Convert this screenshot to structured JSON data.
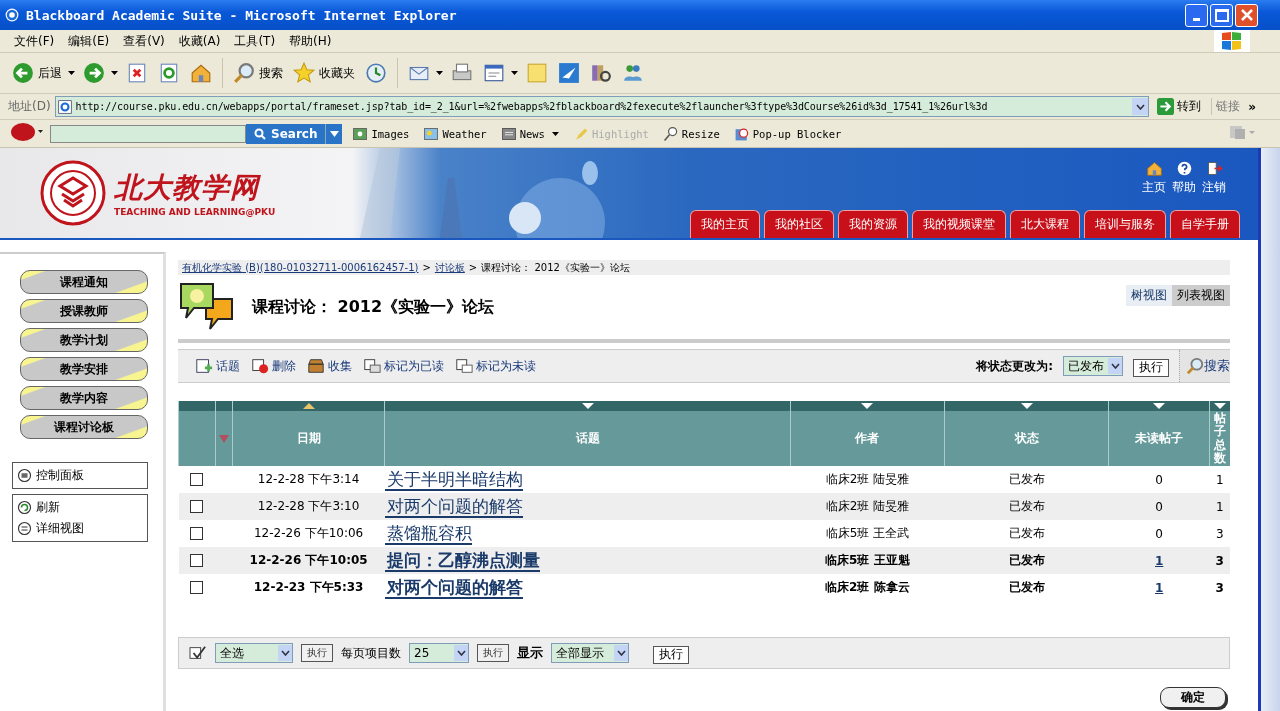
{
  "window": {
    "title": "Blackboard Academic Suite - Microsoft Internet Explorer"
  },
  "menu": [
    "文件(F)",
    "编辑(E)",
    "查看(V)",
    "收藏(A)",
    "工具(T)",
    "帮助(H)"
  ],
  "toolbar": [
    {
      "kind": "back",
      "label": "后退",
      "dropdown": true
    },
    {
      "kind": "forward",
      "dropdown": true
    },
    {
      "kind": "stop"
    },
    {
      "kind": "refresh"
    },
    {
      "kind": "home"
    },
    {
      "kind": "search",
      "label": "搜索"
    },
    {
      "kind": "favorites",
      "label": "收藏夹"
    },
    {
      "kind": "history"
    },
    {
      "kind": "mail",
      "dropdown": true
    },
    {
      "kind": "print"
    },
    {
      "kind": "edit",
      "dropdown": true
    },
    {
      "kind": "note"
    },
    {
      "kind": "messenger"
    },
    {
      "kind": "research"
    },
    {
      "kind": "people"
    }
  ],
  "address": {
    "label": "地址(D)",
    "url": "http://course.pku.edu.cn/webapps/portal/frameset.jsp?tab_id=_2_1&url=%2fwebapps%2fblackboard%2fexecute%2flauncher%3ftype%3dCourse%26id%3d_17541_1%26url%3d",
    "go": "转到",
    "links": "链接",
    "more": "»"
  },
  "askbar": {
    "search_button": "Search",
    "items": [
      {
        "kind": "images",
        "label": "Images",
        "disabled": false
      },
      {
        "kind": "weather",
        "label": "Weather",
        "disabled": false
      },
      {
        "kind": "news",
        "label": "News",
        "disabled": false,
        "dropdown": true
      },
      {
        "kind": "highlight",
        "label": "Highlight",
        "disabled": true
      },
      {
        "kind": "resize",
        "label": "Resize",
        "disabled": false
      },
      {
        "kind": "popup",
        "label": "Pop-up Blocker",
        "disabled": false
      }
    ]
  },
  "banner": {
    "logo": "北大教学网",
    "subtitle": "TEACHING AND LEARNING@PKU",
    "top_links": [
      {
        "kind": "home",
        "label": "主页"
      },
      {
        "kind": "help",
        "label": "帮助"
      },
      {
        "kind": "logout",
        "label": "注销"
      }
    ],
    "tabs": [
      "我的主页",
      "我的社区",
      "我的资源",
      "我的视频课堂",
      "北大课程",
      "培训与服务",
      "自学手册"
    ]
  },
  "sidebar": {
    "buttons": [
      "课程通知",
      "授课教师",
      "教学计划",
      "教学安排",
      "教学内容",
      "课程讨论板"
    ],
    "panels": [
      [
        {
          "kind": "panel",
          "label": "控制面板"
        }
      ],
      [
        {
          "kind": "refresh",
          "label": "刷新"
        },
        {
          "kind": "detail",
          "label": "详细视图"
        }
      ]
    ]
  },
  "breadcrumb": {
    "separator": ">",
    "items": [
      {
        "text": "有机化学实验 (B)(180-01032711-0006162457-1)",
        "link": true
      },
      {
        "text": "讨论板",
        "link": true
      },
      {
        "text": "课程讨论： 2012《实验一》论坛",
        "link": false
      }
    ]
  },
  "page_title": "课程讨论： 2012《实验一》论坛",
  "views": [
    {
      "label": "树视图",
      "selected": false
    },
    {
      "label": "列表视图",
      "selected": true
    }
  ],
  "actions": [
    {
      "kind": "topic",
      "label": "话题"
    },
    {
      "kind": "delete",
      "label": "删除"
    },
    {
      "kind": "collect",
      "label": "收集"
    },
    {
      "kind": "read",
      "label": "标记为已读"
    },
    {
      "kind": "unread",
      "label": "标记为未读"
    }
  ],
  "status_change": {
    "label": "将状态更改为:",
    "value": "已发布",
    "button": "执行",
    "search": "搜索"
  },
  "columns": [
    {
      "label": "日期",
      "sorted": true
    },
    {
      "label": "话题",
      "sorted": false
    },
    {
      "label": "作者",
      "sorted": false
    },
    {
      "label": "状态",
      "sorted": false
    },
    {
      "label": "未读帖子",
      "sorted": false
    },
    {
      "label": "帖子总数",
      "sorted": false
    }
  ],
  "rows": [
    {
      "checked": false,
      "unread": false,
      "date": "12-2-28 下午3:14",
      "topic": "关于半明半暗结构",
      "author": "临床2班 陆旻雅",
      "status": "已发布",
      "unread_count": "0",
      "total": "1"
    },
    {
      "checked": false,
      "unread": false,
      "date": "12-2-28 下午3:10",
      "topic": "对两个问题的解答",
      "author": "临床2班 陆旻雅",
      "status": "已发布",
      "unread_count": "0",
      "total": "1"
    },
    {
      "checked": false,
      "unread": false,
      "date": "12-2-26 下午10:06",
      "topic": "蒸馏瓶容积",
      "author": "临床5班 王全武",
      "status": "已发布",
      "unread_count": "0",
      "total": "3"
    },
    {
      "checked": false,
      "unread": true,
      "date": "12-2-26 下午10:05",
      "topic": "提问：乙醇沸点测量",
      "author": "临床5班 王亚魁",
      "status": "已发布",
      "unread_count": "1",
      "total": "3"
    },
    {
      "checked": false,
      "unread": true,
      "date": "12-2-23 下午5:33",
      "topic": "对两个问题的解答",
      "author": "临床2班 陈拿云",
      "status": "已发布",
      "unread_count": "1",
      "total": "3"
    }
  ],
  "footer": {
    "select": "全选",
    "button1": "执行",
    "per_page_label": "每页项目数",
    "per_page": "25",
    "button2": "执行",
    "show_label": "显示",
    "show": "全部显示",
    "button3": "执行"
  },
  "ok_button": "确定"
}
